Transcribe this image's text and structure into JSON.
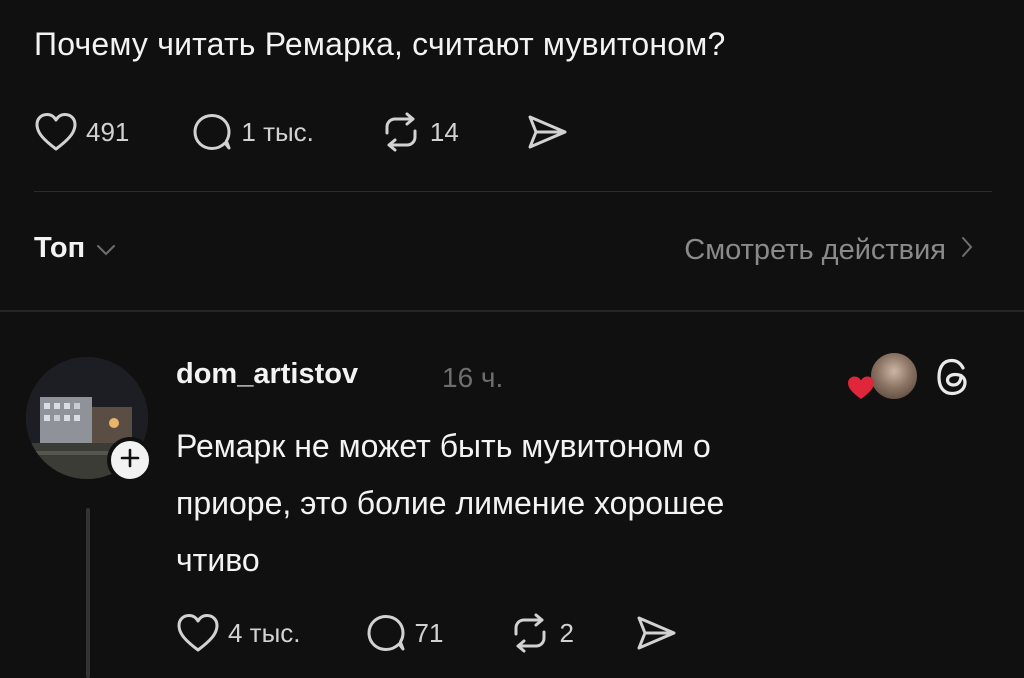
{
  "post": {
    "text": "Почему читать Ремарка, считают мувитоном?",
    "likes": "491",
    "comments": "1 тыс.",
    "reposts": "14"
  },
  "sort": {
    "label": "Топ",
    "view_activity": "Смотреть действия"
  },
  "reply": {
    "username": "dom_artistov",
    "time": "16 ч.",
    "lines": [
      "Ремарк не может быть мувитоном о",
      "приоре, это болие лимение хорошее",
      "чтиво"
    ],
    "likes": "4 тыс.",
    "comments": "71",
    "reposts": "2"
  },
  "colors": {
    "background": "#101010",
    "text": "#f3f3f3",
    "muted": "#8a8a8a",
    "heart": "#e0263a"
  },
  "icons": [
    "heart-icon",
    "comment-icon",
    "repost-icon",
    "share-icon",
    "chevron-down-icon",
    "chevron-right-icon",
    "plus-icon",
    "threads-icon"
  ]
}
